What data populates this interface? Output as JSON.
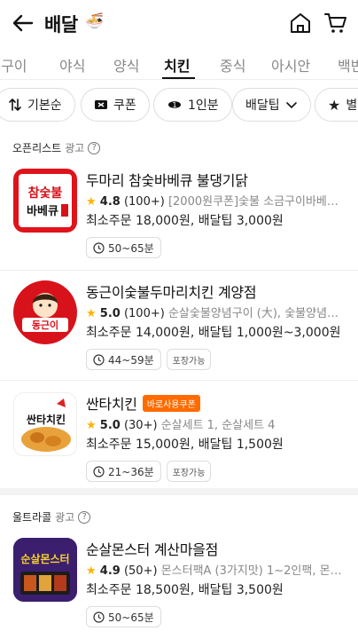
{
  "header": {
    "title": "배달",
    "title_emoji": "🍜"
  },
  "tabs": [
    {
      "label": "·구이"
    },
    {
      "label": "야식"
    },
    {
      "label": "양식"
    },
    {
      "label": "치킨"
    },
    {
      "label": "중식"
    },
    {
      "label": "아시안"
    },
    {
      "label": "백반"
    }
  ],
  "filters": [
    {
      "label": "기본순"
    },
    {
      "label": "쿠폰"
    },
    {
      "label": "1인분"
    },
    {
      "label": "배달팁"
    },
    {
      "label": "별점"
    }
  ],
  "sections": {
    "openlist": {
      "title": "오픈리스트",
      "ad": "광고",
      "help": "?"
    },
    "ultracall": {
      "title": "울트라콜",
      "ad": "광고",
      "help": "?"
    }
  },
  "stores": [
    {
      "name": "두마리 참숯바베큐 불댕기닭",
      "coupon_badge": "",
      "star": "★",
      "rating": "4.8",
      "reviews": "(100+)",
      "menu": "[2000원쿠폰]숯불 소금구이바베…",
      "fees": "최소주문 18,000원, 배달팁 3,000원",
      "time": "50~65분",
      "pickup": "",
      "logo_text_1": "참숯불",
      "logo_text_2": "바베큐"
    },
    {
      "name": "동근이숯불두마리치킨 계양점",
      "coupon_badge": "",
      "star": "★",
      "rating": "5.0",
      "reviews": "(100+)",
      "menu": "순살숯불양념구이 (大), 숯불양념…",
      "fees": "최소주문 14,000원, 배달팁 1,000원~3,000원",
      "time": "44~59분",
      "pickup": "포장가능",
      "logo_text_1": "동근이"
    },
    {
      "name": "싼타치킨",
      "coupon_badge": "바로사용쿠폰",
      "star": "★",
      "rating": "5.0",
      "reviews": "(30+)",
      "menu": "순살세트 1, 순살세트 4",
      "fees": "최소주문 15,000원, 배달팁 1,500원",
      "time": "21~36분",
      "pickup": "포장가능",
      "logo_text_1": "싼타치킨"
    },
    {
      "name": "순살몬스터 계산마을점",
      "coupon_badge": "",
      "star": "★",
      "rating": "4.9",
      "reviews": "(50+)",
      "menu": "몬스터팩A (3가지맛) 1~2인팩, 몬스…",
      "fees": "최소주문 18,500원, 배달팁 3,500원",
      "time": "50~65분",
      "pickup": "",
      "logo_text_1": "순살몬스터"
    }
  ],
  "colors": {
    "accent": "#ff6b00",
    "star": "#ffb300",
    "text": "#111111",
    "muted": "#888888"
  }
}
